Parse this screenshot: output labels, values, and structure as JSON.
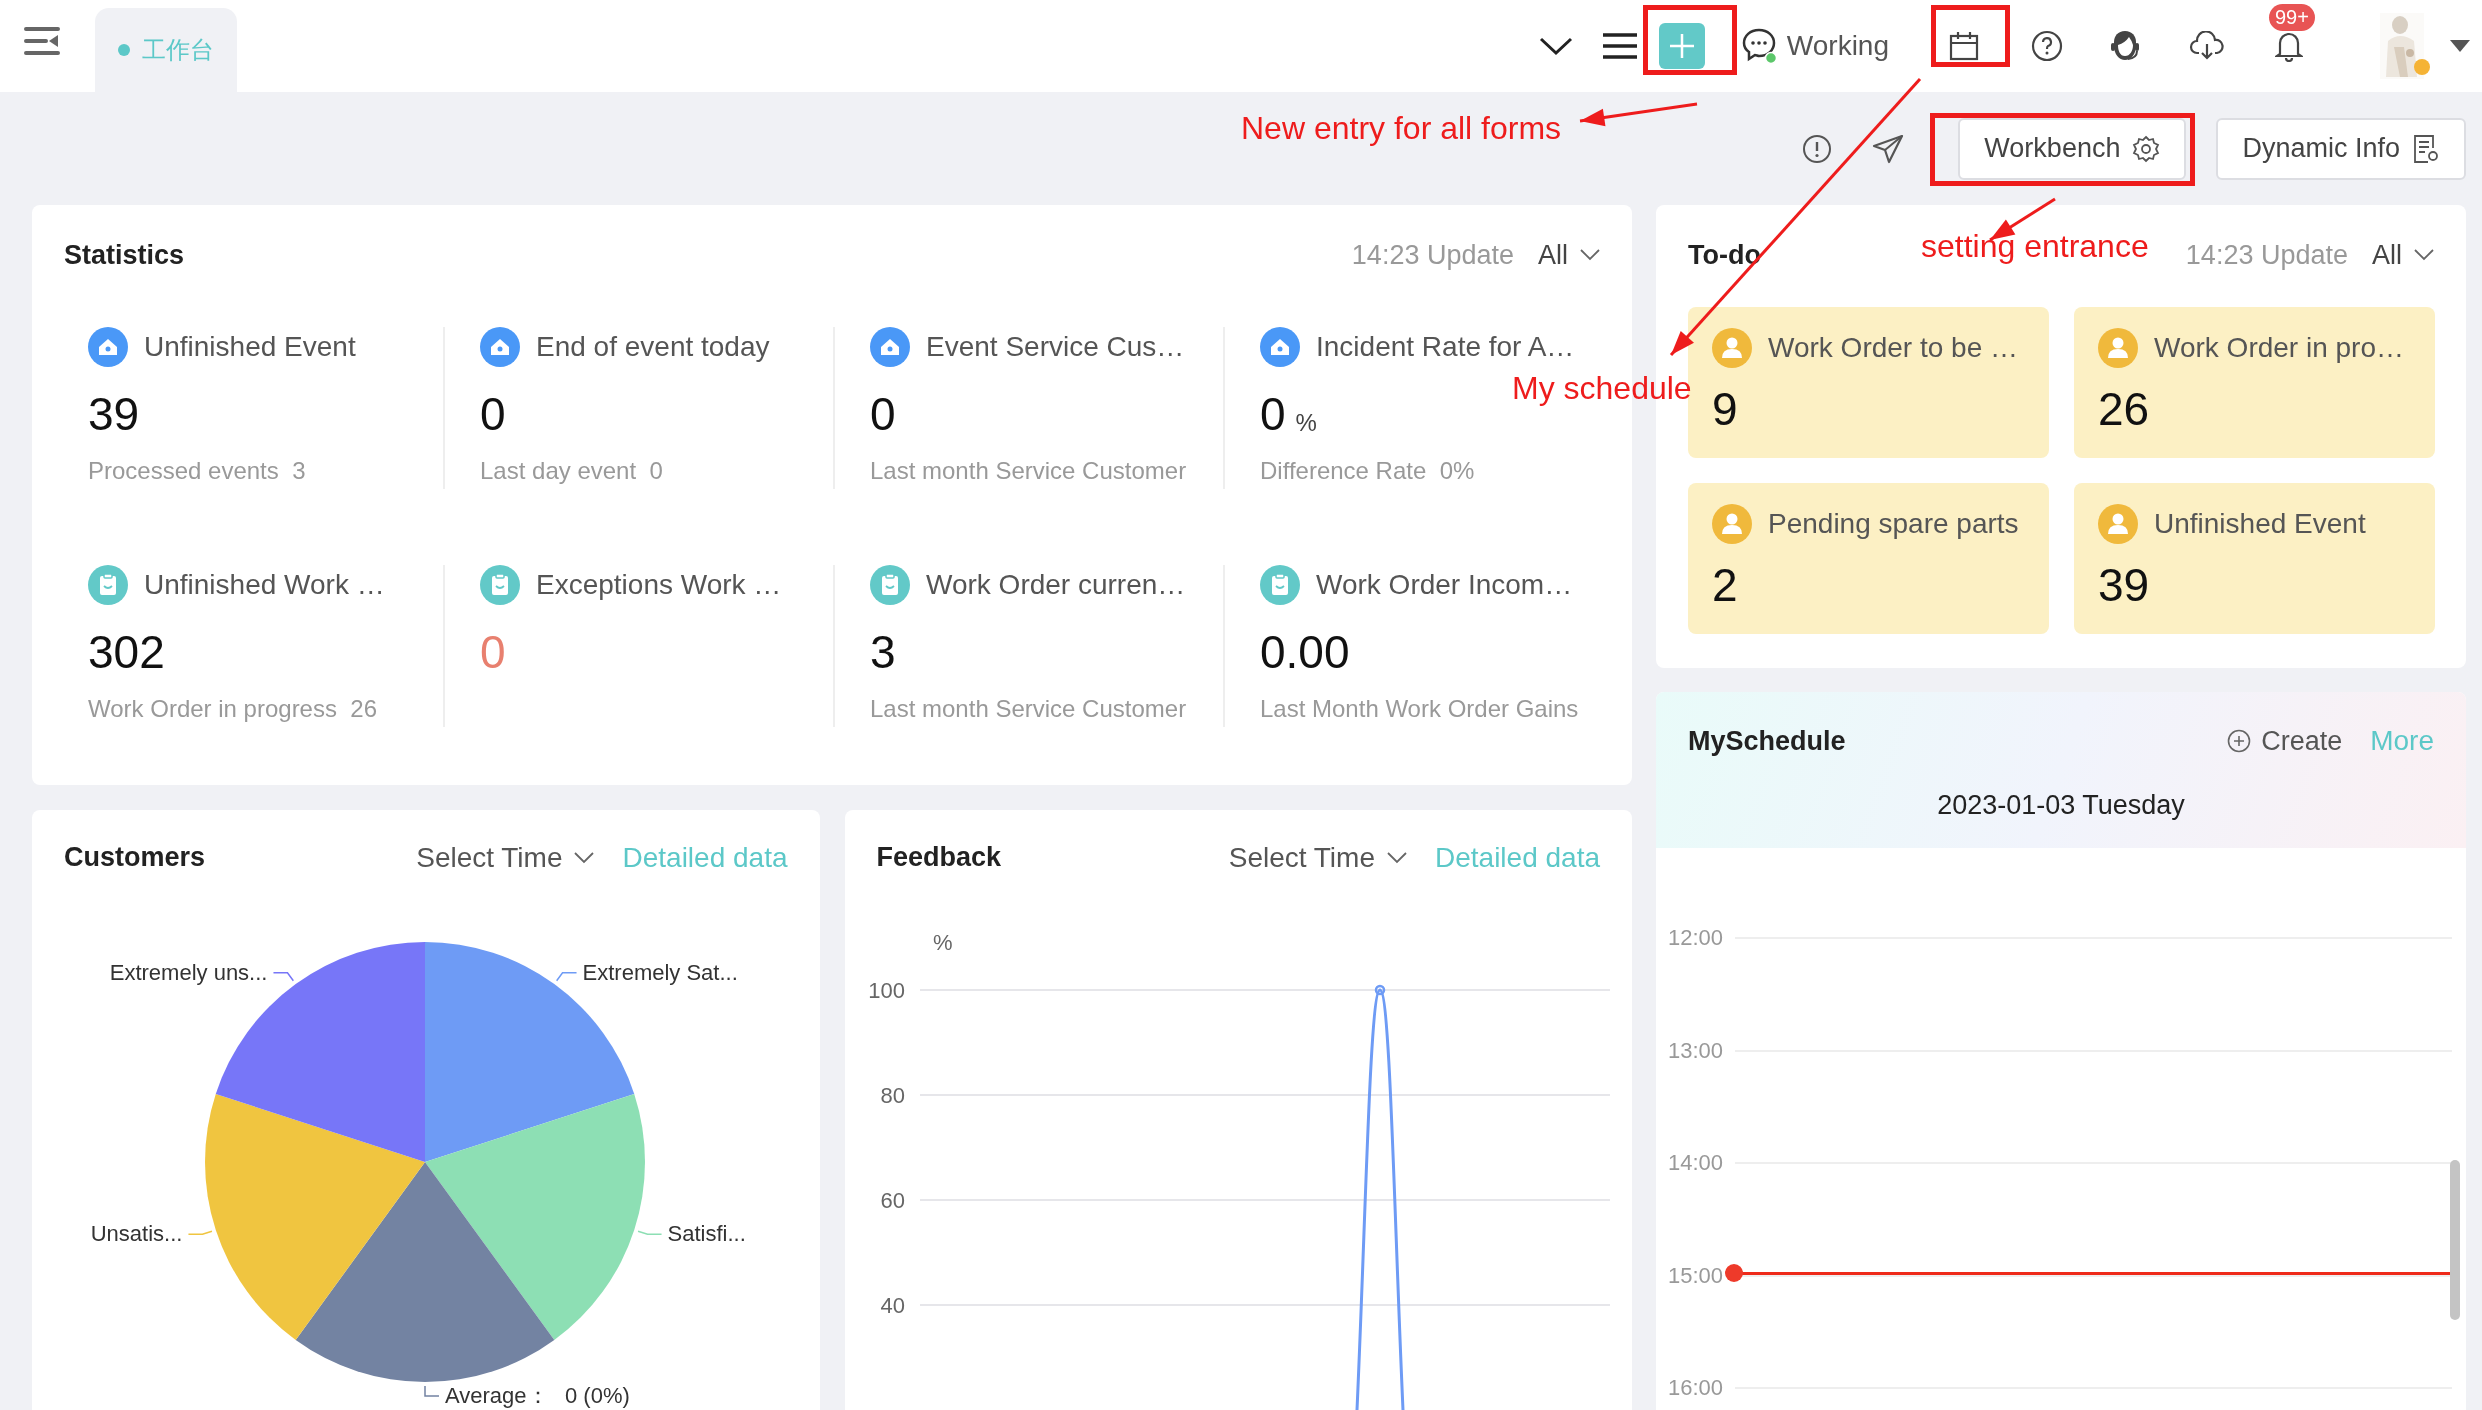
{
  "topbar": {
    "tab": {
      "label": "工作台",
      "selected": true
    },
    "status": "Working",
    "badge": "99+"
  },
  "toolbar": {
    "buttons": [
      {
        "label": "Workbench",
        "kind": "settings"
      },
      {
        "label": "Dynamic Info",
        "kind": "report"
      }
    ]
  },
  "statistics": {
    "title": "Statistics",
    "updated": "14:23 Update",
    "filter": "All",
    "items": [
      {
        "kind": "event",
        "title": "Unfinished Event",
        "value": "39",
        "caption": "Processed events",
        "caption_value": "3",
        "alert": false
      },
      {
        "kind": "event",
        "title": "End of event today",
        "value": "0",
        "caption": "Last day event",
        "caption_value": "0",
        "alert": false
      },
      {
        "kind": "event",
        "title": "Event Service Cus…",
        "value": "0",
        "caption": "Last month Service Customer",
        "alert": false
      },
      {
        "kind": "event",
        "title": "Incident Rate for A…",
        "value": "0",
        "unit": "%",
        "caption": "Difference Rate",
        "caption_value": "0%",
        "alert": false
      },
      {
        "kind": "work_order",
        "title": "Unfinished Work …",
        "value": "302",
        "caption": "Work Order in progress",
        "caption_value": "26",
        "alert": false
      },
      {
        "kind": "work_order",
        "title": "Exceptions Work …",
        "value": "0",
        "alert": true
      },
      {
        "kind": "work_order",
        "title": "Work Order curren…",
        "value": "3",
        "caption": "Last month Service Customer",
        "alert": false
      },
      {
        "kind": "work_order",
        "title": "Work Order Incom…",
        "value": "0.00",
        "caption": "Last Month Work Order Gains",
        "alert": false
      }
    ]
  },
  "todo": {
    "title": "To-do",
    "updated": "14:23 Update",
    "filter": "All",
    "items": [
      {
        "title": "Work Order to be …",
        "value": "9"
      },
      {
        "title": "Work Order in pro…",
        "value": "26"
      },
      {
        "title": "Pending spare parts",
        "value": "2"
      },
      {
        "title": "Unfinished Event",
        "value": "39"
      }
    ]
  },
  "customers": {
    "title": "Customers",
    "time_select": "Select Time",
    "link": "Detailed data",
    "pie_labels": [
      {
        "label": "Extremely Sat..."
      },
      {
        "label": "Satisfi..."
      },
      {
        "label": "Average：",
        "value": "0 (0%)"
      },
      {
        "label": "Unsatis..."
      },
      {
        "label": "Extremely uns..."
      }
    ]
  },
  "feedback": {
    "title": "Feedback",
    "time_select": "Select Time",
    "link": "Detailed data",
    "y_unit": "%",
    "y_labels": [
      "100",
      "80",
      "60",
      "40"
    ]
  },
  "schedule": {
    "title": "MySchedule",
    "create": "Create",
    "more": "More",
    "date": "2023-01-03 Tuesday",
    "hours": [
      {
        "time": "12:00",
        "current": false
      },
      {
        "time": "13:00",
        "current": false
      },
      {
        "time": "14:00",
        "current": false
      },
      {
        "time": "15:00",
        "current": true
      },
      {
        "time": "16:00",
        "current": false
      }
    ]
  },
  "annotations": [
    {
      "text": "New entry for all forms"
    },
    {
      "text": "My schedule"
    },
    {
      "text": "setting entrance"
    }
  ]
}
